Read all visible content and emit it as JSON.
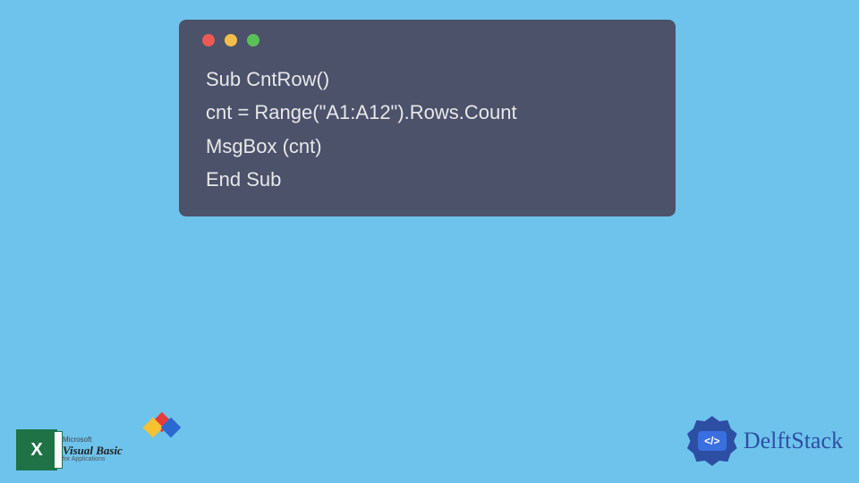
{
  "code": {
    "line1": "Sub CntRow()",
    "line2": "cnt = Range(\"A1:A12\").Rows.Count",
    "line3": "MsgBox (cnt)",
    "line4": "End Sub"
  },
  "icons": {
    "excel_letter": "X",
    "vb_top": "Microsoft",
    "vb_main": "Visual Basic",
    "vb_sub": "for Applications"
  },
  "brand": {
    "slash": "</>",
    "name": "DelftStack"
  }
}
